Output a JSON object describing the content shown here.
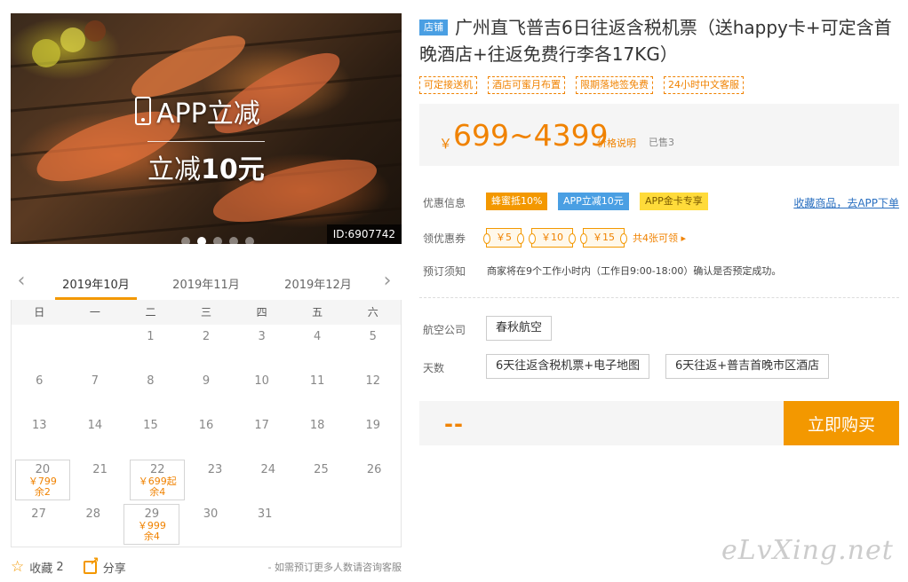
{
  "hero": {
    "promo_line1": "APP立减",
    "promo_line2_prefix": "立减",
    "promo_line2_bold": "10元",
    "id_tag": "ID:6907742",
    "slide_count": 5,
    "active_slide": 2
  },
  "calendar": {
    "prev_label": "‹",
    "next_label": "›",
    "months": [
      "2019年10月",
      "2019年11月",
      "2019年12月"
    ],
    "active_month": 0,
    "weekdays": [
      "日",
      "一",
      "二",
      "三",
      "四",
      "五",
      "六"
    ],
    "weeks": [
      [
        {
          "d": ""
        },
        {
          "d": ""
        },
        {
          "d": "1"
        },
        {
          "d": "2"
        },
        {
          "d": "3"
        },
        {
          "d": "4"
        },
        {
          "d": "5"
        }
      ],
      [
        {
          "d": "6"
        },
        {
          "d": "7"
        },
        {
          "d": "8"
        },
        {
          "d": "9"
        },
        {
          "d": "10"
        },
        {
          "d": "11"
        },
        {
          "d": "12"
        }
      ],
      [
        {
          "d": "13"
        },
        {
          "d": "14"
        },
        {
          "d": "15"
        },
        {
          "d": "16"
        },
        {
          "d": "17"
        },
        {
          "d": "18"
        },
        {
          "d": "19"
        }
      ],
      [
        {
          "d": "20",
          "price": "￥799",
          "left": "余2"
        },
        {
          "d": "21"
        },
        {
          "d": "22",
          "price": "￥699起",
          "left": "余4"
        },
        {
          "d": "23"
        },
        {
          "d": "24"
        },
        {
          "d": "25"
        },
        {
          "d": "26"
        }
      ],
      [
        {
          "d": "27"
        },
        {
          "d": "28"
        },
        {
          "d": "29",
          "price": "￥999",
          "left": "余4"
        },
        {
          "d": "30"
        },
        {
          "d": "31"
        },
        {
          "d": ""
        },
        {
          "d": ""
        }
      ]
    ]
  },
  "footer": {
    "fav_label": "收藏",
    "fav_count": "2",
    "share_label": "分享",
    "note": "- 如需预订更多人数请咨询客服"
  },
  "product": {
    "badge": "店铺",
    "title": "广州直飞普吉6日往返含税机票（送happy卡+可定含首晚酒店+往返免费行李各17KG）",
    "tags": [
      "可定接送机",
      "酒店可蜜月布置",
      "限期落地签免费",
      "24小时中文客服"
    ],
    "currency": "￥",
    "price": "699~4399",
    "price_explain": "价格说明",
    "sold": "已售3"
  },
  "discounts": {
    "label": "优惠信息",
    "pills": [
      {
        "text": "蜂蜜抵10%",
        "style": "orange"
      },
      {
        "text": "APP立减10元",
        "style": "blue"
      },
      {
        "text": "APP金卡专享",
        "style": "yellow"
      }
    ],
    "fav_link": "收藏商品，去APP下单"
  },
  "coupons": {
    "label": "领优惠券",
    "items": [
      "￥5",
      "￥10",
      "￥15"
    ],
    "more": "共4张可领 ▸"
  },
  "booking": {
    "label": "预订须知",
    "text": "商家将在9个工作小时内（工作日9:00-18:00）确认是否预定成功。"
  },
  "airline": {
    "label": "航空公司",
    "options": [
      "春秋航空"
    ]
  },
  "days": {
    "label": "天数",
    "options": [
      "6天往返含税机票+电子地图",
      "6天往返+普吉首晚市区酒店"
    ]
  },
  "buy": {
    "price_placeholder": "--",
    "button": "立即购买"
  },
  "watermark": "eLvXing.net",
  "colors": {
    "accent": "#f39800",
    "price": "#f08200",
    "blue": "#4a9fe3"
  }
}
